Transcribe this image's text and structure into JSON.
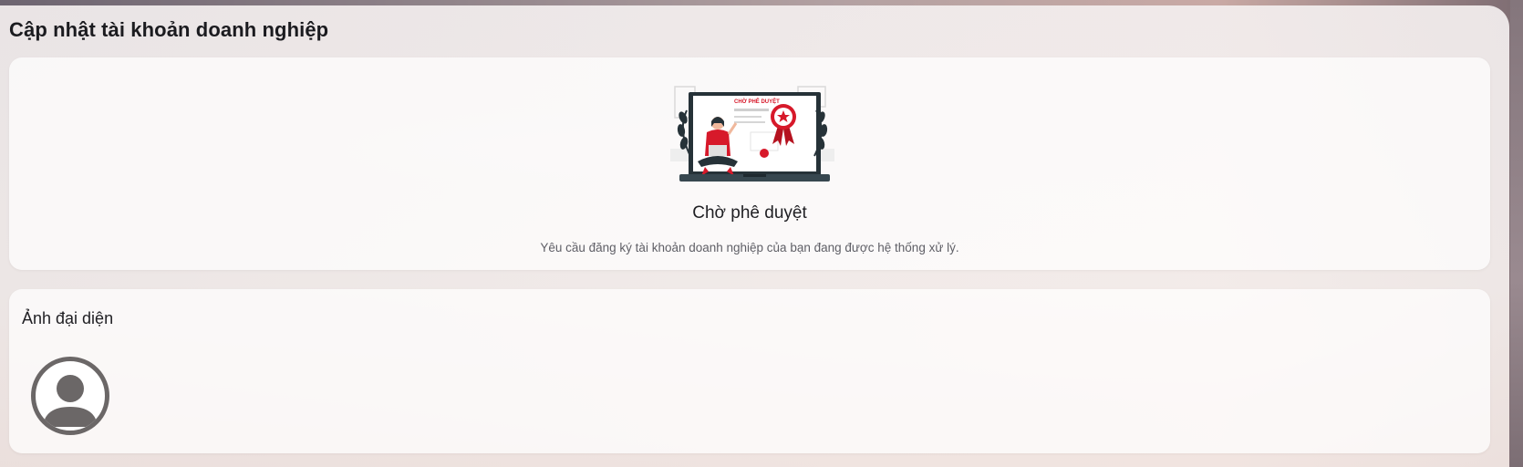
{
  "page": {
    "title": "Cập nhật tài khoản doanh nghiệp"
  },
  "status_card": {
    "illustration_label": "CHỜ PHÊ DUYỆT",
    "title": "Chờ phê duyệt",
    "description": "Yêu cầu đăng ký tài khoản doanh nghiệp của bạn đang được hệ thống xử lý."
  },
  "avatar_section": {
    "title": "Ảnh đại diện",
    "avatar_icon": "user-placeholder-icon"
  },
  "colors": {
    "accent": "#d7192a",
    "dark": "#263238",
    "avatar_gray": "#6b6767"
  }
}
